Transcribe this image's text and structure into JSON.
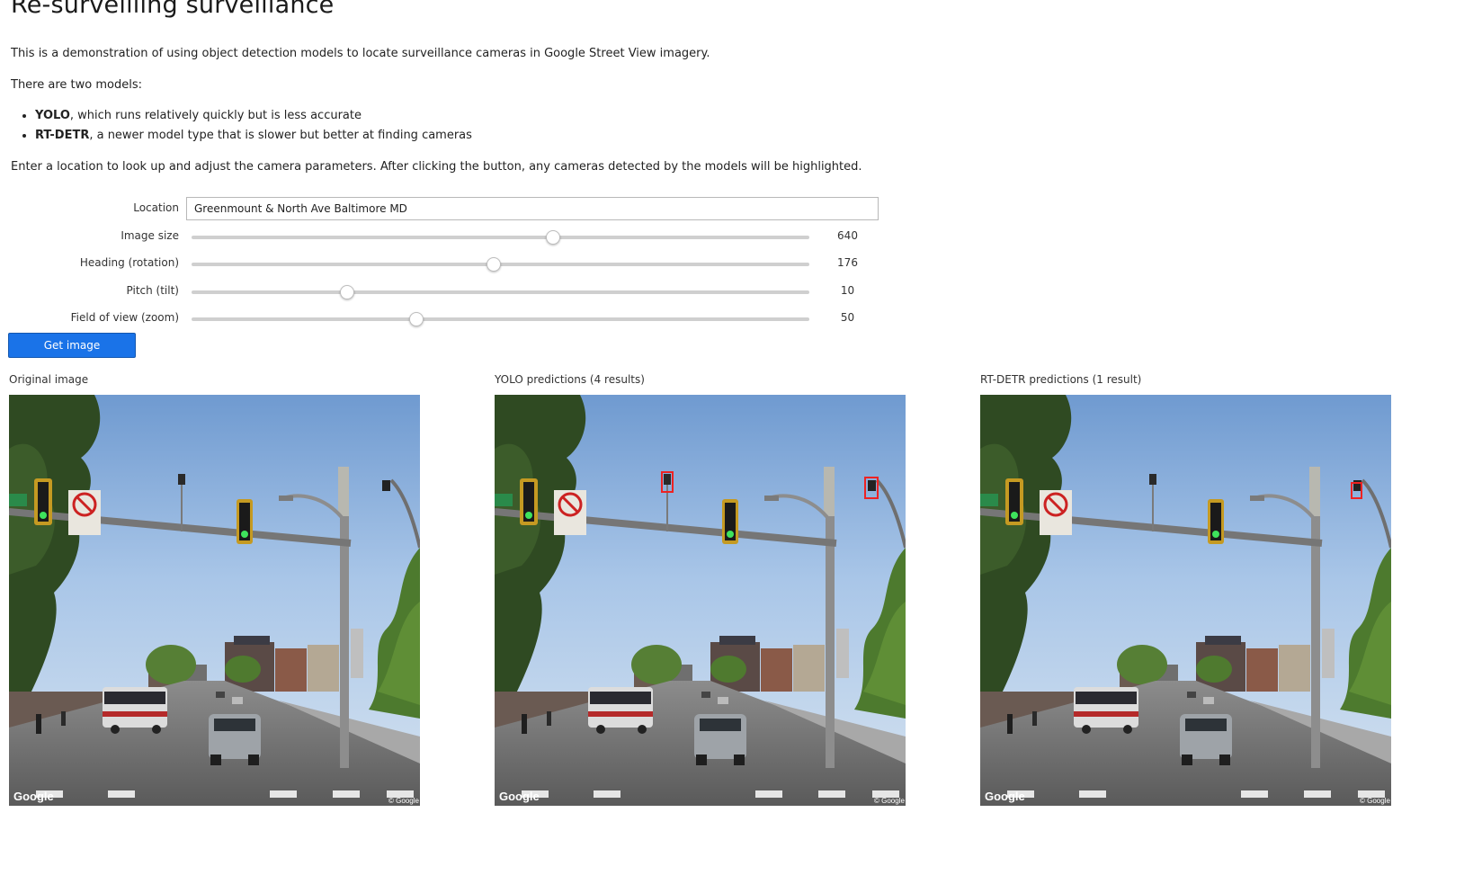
{
  "page": {
    "title": "Re-surveilling surveillance",
    "intro": "This is a demonstration of using object detection models to locate surveillance cameras in Google Street View imagery.",
    "models_intro": "There are two models:",
    "models": [
      {
        "name": "YOLO",
        "desc": ", which runs relatively quickly but is less accurate"
      },
      {
        "name": "RT-DETR",
        "desc": ", a newer model type that is slower but better at finding cameras"
      }
    ],
    "instructions": "Enter a location to look up and adjust the camera parameters. After clicking the button, any cameras detected by the models will be highlighted."
  },
  "form": {
    "location": {
      "label": "Location",
      "value": "Greenmount & North Ave Baltimore MD"
    },
    "sliders": [
      {
        "label": "Image size",
        "value": "640",
        "fraction": 0.583
      },
      {
        "label": "Heading (rotation)",
        "value": "176",
        "fraction": 0.487
      },
      {
        "label": "Pitch (tilt)",
        "value": "10",
        "fraction": 0.25
      },
      {
        "label": "Field of view (zoom)",
        "value": "50",
        "fraction": 0.363
      }
    ],
    "button_label": "Get image"
  },
  "panels": [
    {
      "title": "Original image",
      "logo": "Google",
      "copyright": "© Google"
    },
    {
      "title": "YOLO predictions (4 results)",
      "logo": "Google",
      "copyright": "© Google"
    },
    {
      "title": "RT-DETR predictions (1 result)",
      "logo": "Google",
      "copyright": "© Google"
    }
  ],
  "colors": {
    "accent": "#1a73e8",
    "detection_box": "#e22222"
  }
}
